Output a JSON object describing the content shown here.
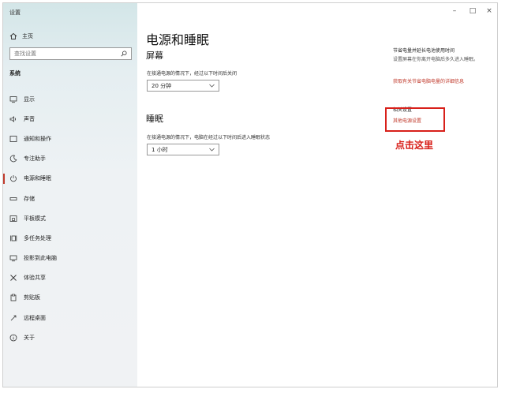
{
  "window": {
    "title": "设置",
    "minimize": "–",
    "maximize": "□",
    "close": "×"
  },
  "sidebar": {
    "home_label": "主页",
    "search_placeholder": "查找设置",
    "section_label": "系统",
    "items": [
      {
        "label": "显示",
        "icon": "monitor-icon"
      },
      {
        "label": "声音",
        "icon": "speaker-icon"
      },
      {
        "label": "通知和操作",
        "icon": "notification-icon"
      },
      {
        "label": "专注助手",
        "icon": "moon-icon"
      },
      {
        "label": "电源和睡眠",
        "icon": "power-icon",
        "active": true
      },
      {
        "label": "存储",
        "icon": "storage-icon"
      },
      {
        "label": "平板模式",
        "icon": "tablet-icon"
      },
      {
        "label": "多任务处理",
        "icon": "multitask-icon"
      },
      {
        "label": "投影到此电脑",
        "icon": "project-icon"
      },
      {
        "label": "体验共享",
        "icon": "share-icon"
      },
      {
        "label": "剪贴板",
        "icon": "clipboard-icon"
      },
      {
        "label": "远程桌面",
        "icon": "remote-icon"
      },
      {
        "label": "关于",
        "icon": "info-icon"
      }
    ]
  },
  "main": {
    "title": "电源和睡眠",
    "screen": {
      "heading": "屏幕",
      "description": "在接通电源的情况下，经过以下时间后关闭",
      "value": "20 分钟"
    },
    "sleep": {
      "heading": "睡眠",
      "description": "在接通电源的情况下，电脑在经过以下时间后进入睡眠状态",
      "value": "1 小时"
    }
  },
  "right": {
    "save_heading": "节省电量并延长电池使用时间",
    "save_text": "设置屏幕在你离开电脑后多久进入睡眠。",
    "save_link": "获取有关节省电脑电量的详细信息",
    "related_heading": "相关设置",
    "related_link": "其他电源设置"
  },
  "annotation": {
    "text": "点击这里",
    "color": "#d8201a"
  },
  "colors": {
    "accent": "#c0392b",
    "sidebar_bg": "#eef2f4"
  }
}
